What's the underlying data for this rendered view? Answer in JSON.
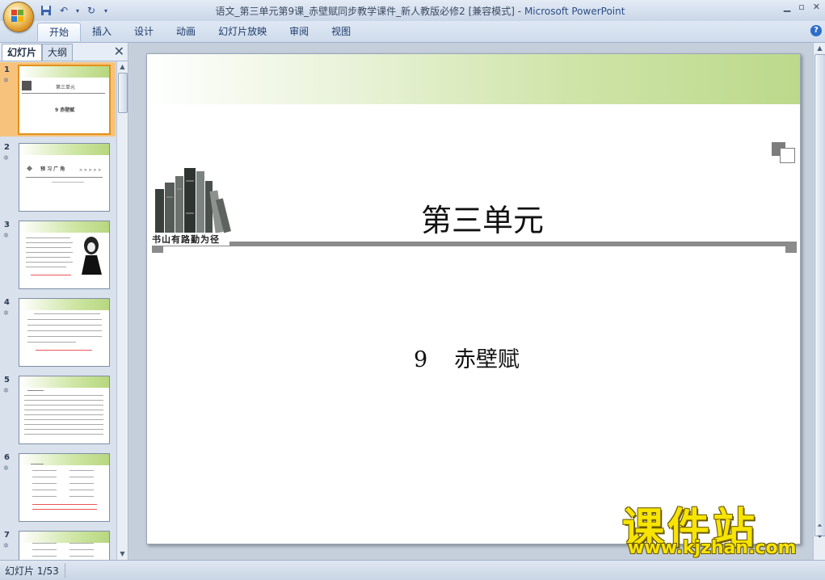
{
  "window": {
    "title_doc": "语文_第三单元第9课_赤壁赋同步教学课件_新人教版必修2 [兼容模式]",
    "title_sep": " - ",
    "title_app": "Microsoft PowerPoint"
  },
  "ribbon": {
    "tabs": [
      "开始",
      "插入",
      "设计",
      "动画",
      "幻灯片放映",
      "审阅",
      "视图"
    ],
    "active_tab": "开始"
  },
  "left_pane": {
    "tab_slides": "幻灯片",
    "tab_outline": "大纲",
    "close_glyph": "✕",
    "thumbnails": [
      {
        "num": "1",
        "title": "第三单元",
        "sub": "9 赤壁赋"
      },
      {
        "num": "2",
        "title": "预 习 广 角",
        "sub": "> > > > >"
      },
      {
        "num": "3"
      },
      {
        "num": "4"
      },
      {
        "num": "5"
      },
      {
        "num": "6"
      },
      {
        "num": "7"
      }
    ]
  },
  "slide": {
    "unit_title": "第三单元",
    "motto": "书山有路勤为径",
    "lesson_number": "9",
    "lesson_title": "赤壁赋"
  },
  "watermark": {
    "cn": "课件站",
    "url": "www.kjzhan.com"
  },
  "status_bar": {
    "slide_indicator": "幻灯片 1/53"
  },
  "colors": {
    "accent_green": "#bcd98b",
    "selection_orange": "#f7c37c",
    "watermark_yellow": "#f7e400"
  }
}
